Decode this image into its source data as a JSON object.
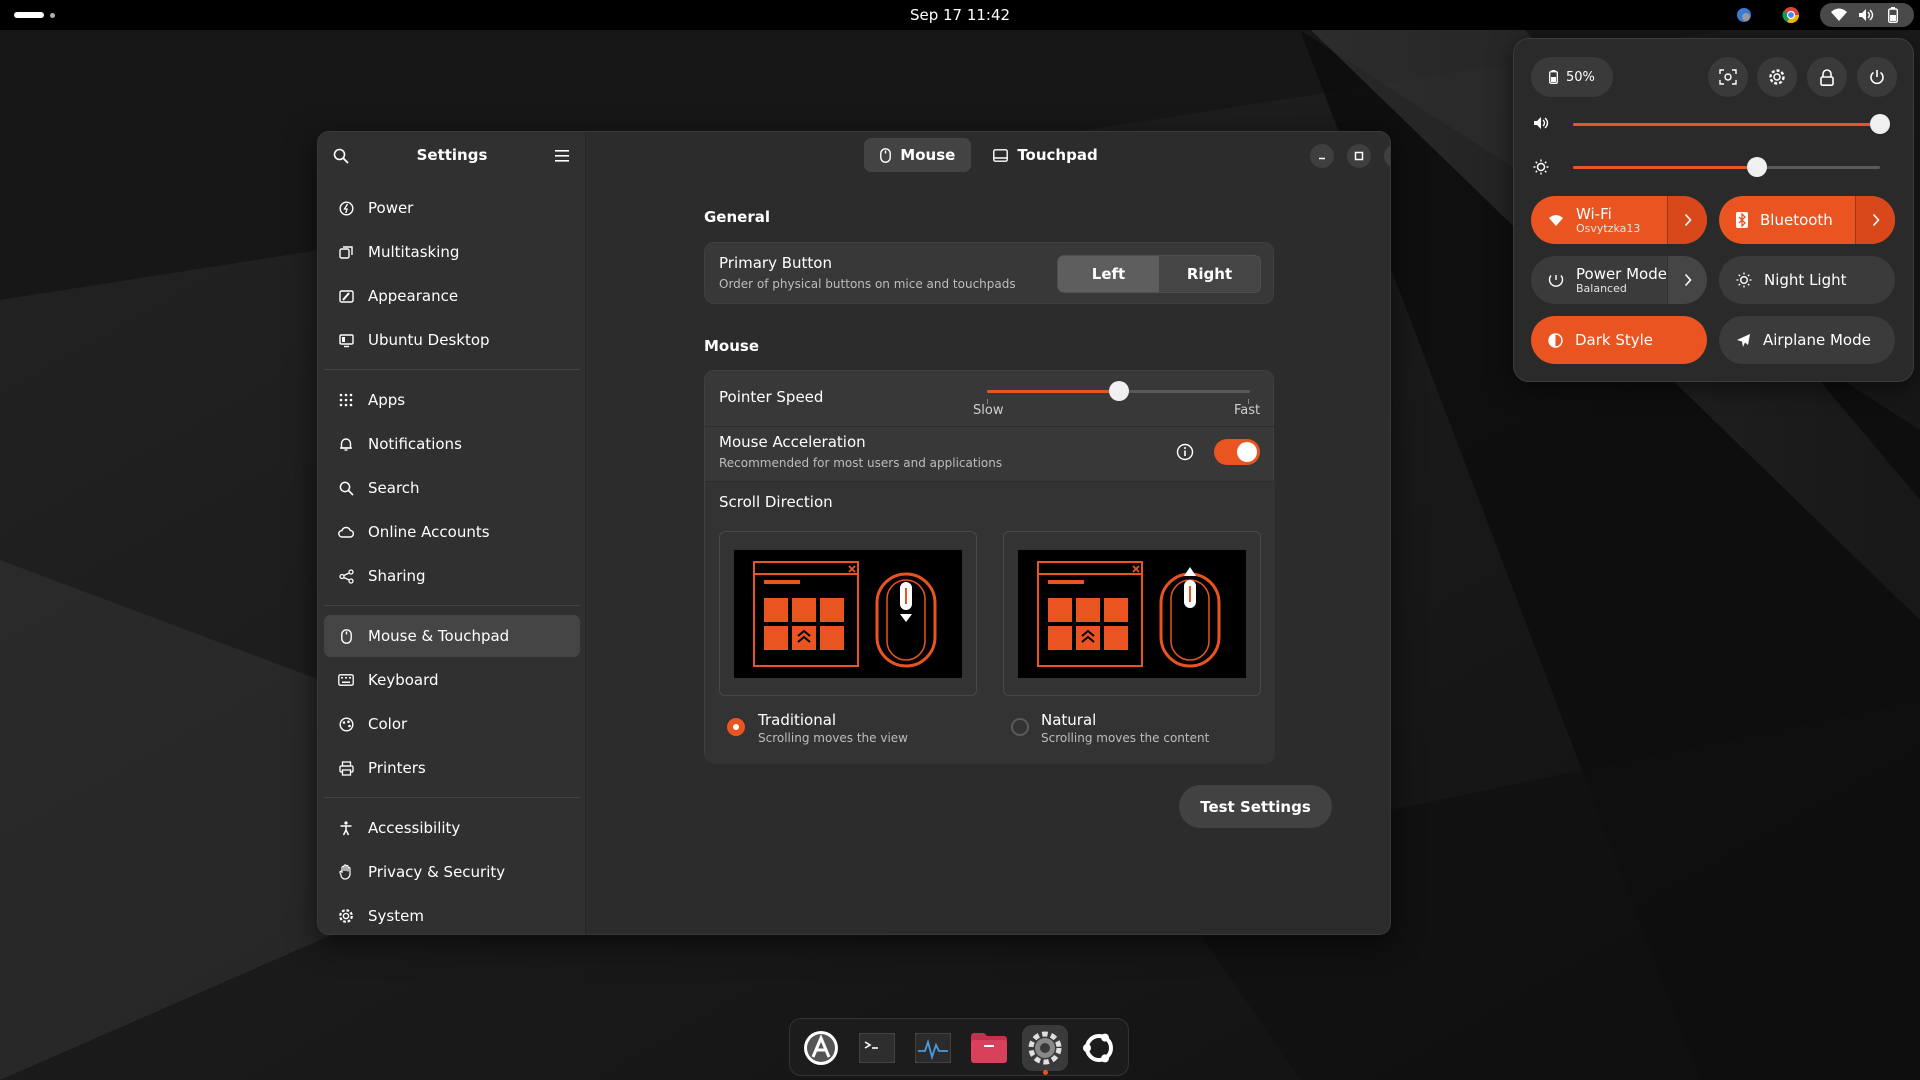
{
  "topbar": {
    "datetime": "Sep 17  11:42"
  },
  "settings": {
    "sidebar_title": "Settings",
    "nav_groups": [
      [
        {
          "label": "Power",
          "icon": "power-icon"
        },
        {
          "label": "Multitasking",
          "icon": "multitasking-icon"
        },
        {
          "label": "Appearance",
          "icon": "appearance-icon"
        },
        {
          "label": "Ubuntu Desktop",
          "icon": "ubuntu-desktop-icon"
        }
      ],
      [
        {
          "label": "Apps",
          "icon": "apps-grid-icon"
        },
        {
          "label": "Notifications",
          "icon": "bell-icon"
        },
        {
          "label": "Search",
          "icon": "search-icon"
        },
        {
          "label": "Online Accounts",
          "icon": "cloud-icon"
        },
        {
          "label": "Sharing",
          "icon": "share-icon"
        }
      ],
      [
        {
          "label": "Mouse & Touchpad",
          "icon": "mouse-icon",
          "active": true
        },
        {
          "label": "Keyboard",
          "icon": "keyboard-icon"
        },
        {
          "label": "Color",
          "icon": "color-icon"
        },
        {
          "label": "Printers",
          "icon": "printer-icon"
        }
      ],
      [
        {
          "label": "Accessibility",
          "icon": "accessibility-icon"
        },
        {
          "label": "Privacy & Security",
          "icon": "hand-icon"
        },
        {
          "label": "System",
          "icon": "gear-icon"
        }
      ]
    ],
    "tabs": [
      {
        "label": "Mouse",
        "active": true
      },
      {
        "label": "Touchpad",
        "active": false
      }
    ],
    "general": {
      "title": "General",
      "primary_button": {
        "title": "Primary Button",
        "subtitle": "Order of physical buttons on mice and touchpads",
        "options": [
          "Left",
          "Right"
        ],
        "selected": "Left"
      }
    },
    "mouse": {
      "title": "Mouse",
      "pointer_speed": {
        "title": "Pointer Speed",
        "min_label": "Slow",
        "max_label": "Fast",
        "value": 0.5
      },
      "acceleration": {
        "title": "Mouse Acceleration",
        "subtitle": "Recommended for most users and applications",
        "enabled": true
      },
      "scroll": {
        "title": "Scroll Direction",
        "options": [
          {
            "title": "Traditional",
            "subtitle": "Scrolling moves the view",
            "selected": true
          },
          {
            "title": "Natural",
            "subtitle": "Scrolling moves the content",
            "selected": false
          }
        ]
      }
    },
    "test_button": "Test Settings"
  },
  "quick_settings": {
    "battery": "50%",
    "volume": 1.0,
    "brightness": 0.6,
    "tiles": {
      "wifi": {
        "label": "Wi-Fi",
        "sub": "Osvytzka13",
        "active": true
      },
      "bluetooth": {
        "label": "Bluetooth",
        "active": true
      },
      "power_mode": {
        "label": "Power Mode",
        "sub": "Balanced",
        "active": false
      },
      "night_light": {
        "label": "Night Light",
        "active": false
      },
      "dark_style": {
        "label": "Dark Style",
        "active": true
      },
      "airplane": {
        "label": "Airplane Mode",
        "active": false
      }
    }
  },
  "colors": {
    "accent": "#e95420",
    "panel": "#2c2c2c",
    "sidebar": "#303030"
  }
}
